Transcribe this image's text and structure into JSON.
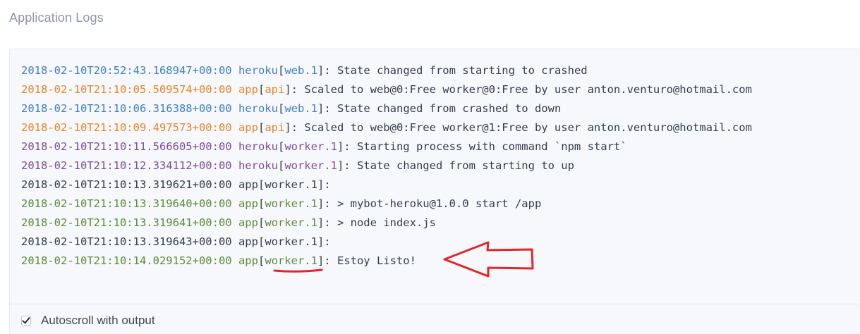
{
  "page": {
    "title": "Application Logs"
  },
  "colors": {
    "heroku_web": "#3f7fc4",
    "api": "#e5852b",
    "heroku_worker": "#7b4f9c",
    "plain": "#333c4e",
    "app_worker": "#5e8a3a",
    "annotation": "#e1262b"
  },
  "log_lines": [
    {
      "timestamp": "2018-02-10T20:52:43.168947+00:00",
      "source": "heroku",
      "dyno": "web.1",
      "message": "State changed from starting to crashed",
      "color": "#3f7fc4"
    },
    {
      "timestamp": "2018-02-10T21:10:05.509574+00:00",
      "source": "app",
      "dyno": "api",
      "message": "Scaled to web@0:Free worker@0:Free by user anton.venturo@hotmail.com",
      "color": "#e5852b"
    },
    {
      "timestamp": "2018-02-10T21:10:06.316388+00:00",
      "source": "heroku",
      "dyno": "web.1",
      "message": "State changed from crashed to down",
      "color": "#3f7fc4"
    },
    {
      "timestamp": "2018-02-10T21:10:09.497573+00:00",
      "source": "app",
      "dyno": "api",
      "message": "Scaled to web@0:Free worker@1:Free by user anton.venturo@hotmail.com",
      "color": "#e5852b"
    },
    {
      "timestamp": "2018-02-10T21:10:11.566605+00:00",
      "source": "heroku",
      "dyno": "worker.1",
      "message": "Starting process with command `npm start`",
      "color": "#7b4f9c"
    },
    {
      "timestamp": "2018-02-10T21:10:12.334112+00:00",
      "source": "heroku",
      "dyno": "worker.1",
      "message": "State changed from starting to up",
      "color": "#7b4f9c"
    },
    {
      "timestamp": "2018-02-10T21:10:13.319621+00:00",
      "source": "app",
      "dyno": "worker.1",
      "message": "",
      "color": "#333c4e"
    },
    {
      "timestamp": "2018-02-10T21:10:13.319640+00:00",
      "source": "app",
      "dyno": "worker.1",
      "message": "> mybot-heroku@1.0.0 start /app",
      "color": "#5e8a3a"
    },
    {
      "timestamp": "2018-02-10T21:10:13.319641+00:00",
      "source": "app",
      "dyno": "worker.1",
      "message": "> node index.js",
      "color": "#5e8a3a"
    },
    {
      "timestamp": "2018-02-10T21:10:13.319643+00:00",
      "source": "app",
      "dyno": "worker.1",
      "message": "",
      "color": "#333c4e"
    },
    {
      "timestamp": "2018-02-10T21:10:14.029152+00:00",
      "source": "app",
      "dyno": "worker.1",
      "message": "Estoy Listo!",
      "color": "#5e8a3a"
    }
  ],
  "autoscroll": {
    "label": "Autoscroll with output",
    "checked": true
  }
}
